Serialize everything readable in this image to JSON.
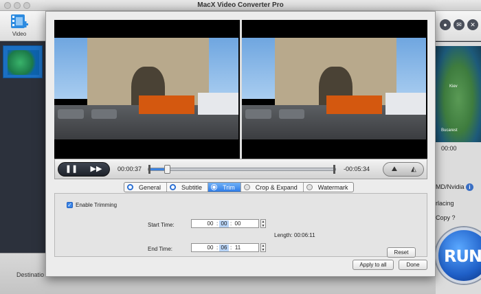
{
  "app": {
    "window_title": "MacX Video Converter Pro",
    "toolbar_video_label": "Video",
    "bottom_destination_label": "Destinatio",
    "right_panel": {
      "time_fragment": "00:00",
      "gpu_label": "MD/Nvidia",
      "interlacing_label": "rlacing",
      "copy_label": "Copy",
      "copy_help": "?",
      "run_label": "RUN",
      "map_cities": [
        "Kiev",
        "Bucarest"
      ]
    }
  },
  "dialog": {
    "playback": {
      "current_time": "00:00:37",
      "remaining_time": "-00:05:34",
      "progress_percent": 10
    },
    "tabs": [
      {
        "label": "General",
        "active": false
      },
      {
        "label": "Subtitle",
        "active": false
      },
      {
        "label": "Trim",
        "active": true
      },
      {
        "label": "Crop & Expand",
        "active": false
      },
      {
        "label": "Watermark",
        "active": false
      }
    ],
    "trim": {
      "enable_label": "Enable Trimming",
      "enable_checked": true,
      "start_label": "Start Time:",
      "start_hh": "00",
      "start_mm": "00",
      "start_ss": "00",
      "end_label": "End Time:",
      "end_hh": "00",
      "end_mm": "06",
      "end_ss": "11",
      "length_label": "Length:",
      "length_value": "00:06:11",
      "reset_label": "Reset"
    },
    "footer": {
      "apply_all_label": "Apply to all",
      "done_label": "Done"
    }
  }
}
